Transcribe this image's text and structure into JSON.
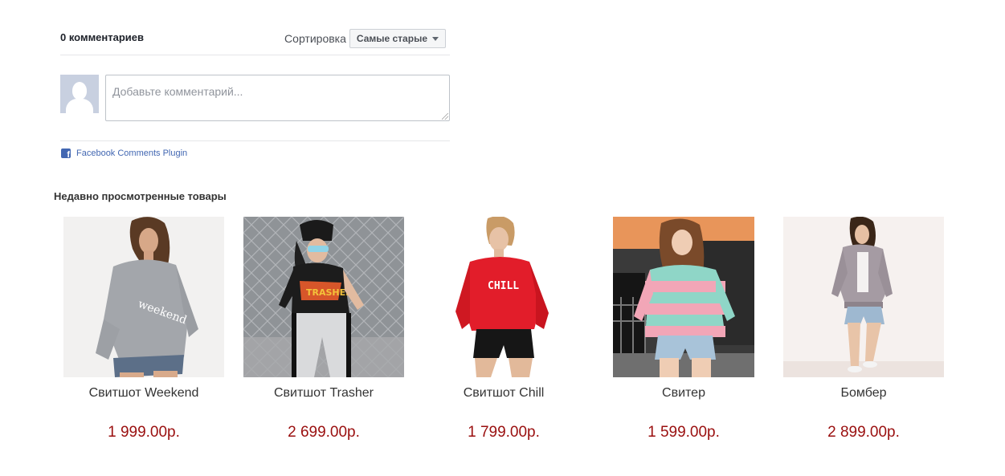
{
  "comments": {
    "count_label": "0 комментариев",
    "sort_label": "Сортировка",
    "sort_value": "Самые старые",
    "input_placeholder": "Добавьте комментарий...",
    "plugin_label": "Facebook Comments Plugin"
  },
  "recent": {
    "title": "Недавно просмотренные товары",
    "products": [
      {
        "name": "Свитшот Weekend",
        "price": "1 999.00р.",
        "image": "grey-sweatshirt-photo"
      },
      {
        "name": "Свитшот Trasher",
        "price": "2 699.00р.",
        "image": "black-print-top-photo"
      },
      {
        "name": "Свитшот Chill",
        "price": "1 799.00р.",
        "image": "red-sweatshirt-photo"
      },
      {
        "name": "Свитер",
        "price": "1 599.00р.",
        "image": "striped-sweater-photo"
      },
      {
        "name": "Бомбер",
        "price": "2 899.00р.",
        "image": "grey-bomber-photo"
      }
    ]
  },
  "colors": {
    "price": "#9a0f0f",
    "facebook_blue": "#4267b2"
  }
}
